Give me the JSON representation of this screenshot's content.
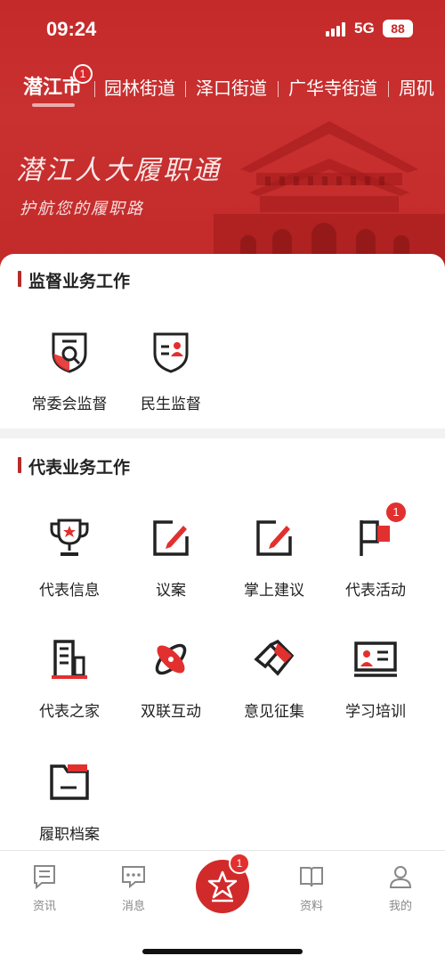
{
  "status": {
    "time": "09:24",
    "network": "5G",
    "battery": "88"
  },
  "tabs": [
    {
      "label": "潜江市",
      "badge": "1"
    },
    {
      "label": "园林街道"
    },
    {
      "label": "泽口街道"
    },
    {
      "label": "广华寺街道"
    },
    {
      "label": "周矶"
    }
  ],
  "banner": {
    "title": "潜江人大履职通",
    "subtitle": "护航您的履职路"
  },
  "supervision": {
    "title": "监督业务工作",
    "items": [
      {
        "label": "常委会监督",
        "icon": "committee-supervision-icon"
      },
      {
        "label": "民生监督",
        "icon": "livelihood-supervision-icon"
      }
    ]
  },
  "representative": {
    "title": "代表业务工作",
    "items": [
      {
        "label": "代表信息",
        "icon": "trophy-icon"
      },
      {
        "label": "议案",
        "icon": "edit-icon"
      },
      {
        "label": "掌上建议",
        "icon": "edit-icon"
      },
      {
        "label": "代表活动",
        "icon": "flag-icon",
        "badge": "1"
      },
      {
        "label": "代表之家",
        "icon": "building-icon"
      },
      {
        "label": "双联互动",
        "icon": "interaction-icon"
      },
      {
        "label": "意见征集",
        "icon": "handshake-icon"
      },
      {
        "label": "学习培训",
        "icon": "training-icon"
      },
      {
        "label": "履职档案",
        "icon": "folder-icon"
      }
    ]
  },
  "bottomnav": {
    "items": [
      {
        "label": "资讯",
        "icon": "news-icon"
      },
      {
        "label": "消息",
        "icon": "message-icon"
      },
      {
        "label": "",
        "icon": "home-star-icon",
        "badge": "1"
      },
      {
        "label": "资料",
        "icon": "book-icon"
      },
      {
        "label": "我的",
        "icon": "user-icon"
      }
    ]
  },
  "colors": {
    "primary": "#c52a2a",
    "accent": "#e2302f"
  }
}
